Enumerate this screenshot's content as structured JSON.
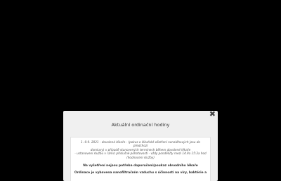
{
  "dialog": {
    "close_symbol": "✖",
    "title": "Aktuální ordinační hodiny",
    "notice_lines": [
      "1.-9.9. 2021 - dovolená lékaře - (pokus o lékařské ošetření nenaléhavých jsou do předchozí",
      "domluvy) v případě stanovených termínech během dovolené lékaře",
      "- ustanovení službu v rámci příslušné pohotovosti - vždy pondělí/ty mezi 14.9a 15:3a hod",
      "(hodnocení služby)"
    ],
    "strong_line_1": "Na vyšetření nejsou potřeba doporučení/poukaz obvodního lékaře",
    "strong_line_2": "Ordinace je vybavena nanofiltračním vzduchu s účinností na viry, baktérie a"
  }
}
